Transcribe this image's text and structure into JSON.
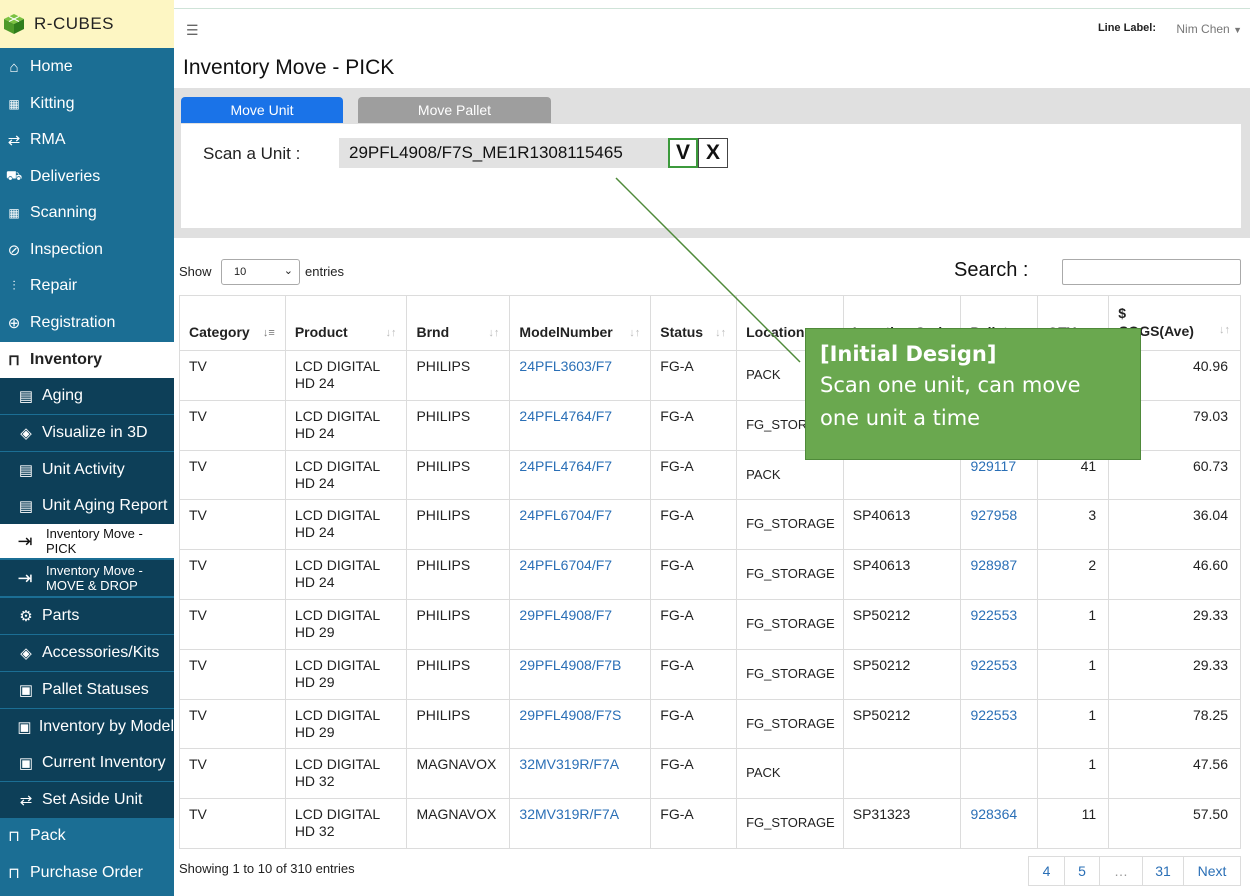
{
  "brand": {
    "name": "R-CUBES"
  },
  "sidebar": {
    "items": [
      {
        "label": "Home",
        "icon": "home-icon"
      },
      {
        "label": "Kitting",
        "icon": "qr-icon"
      },
      {
        "label": "RMA",
        "icon": "swap-icon"
      },
      {
        "label": "Deliveries",
        "icon": "truck-icon"
      },
      {
        "label": "Scanning",
        "icon": "qr-icon"
      },
      {
        "label": "Inspection",
        "icon": "compass-icon"
      },
      {
        "label": "Repair",
        "icon": "sliders-icon"
      },
      {
        "label": "Registration",
        "icon": "plus-circle-icon"
      },
      {
        "label": "Inventory",
        "icon": "bag-icon"
      }
    ],
    "sub_items": [
      {
        "label": "Aging",
        "icon": "clipboard-icon"
      },
      {
        "label": "Visualize in 3D",
        "icon": "cube-icon"
      },
      {
        "label": "Unit Activity",
        "icon": "clipboard-icon"
      },
      {
        "label": "Unit Aging Report",
        "icon": "clipboard-icon"
      },
      {
        "label": "Inventory Move - PICK",
        "icon": "move-icon"
      },
      {
        "label": "Inventory Move -MOVE & DROP",
        "icon": "move-icon"
      },
      {
        "label": "Parts",
        "icon": "gear-icon"
      },
      {
        "label": "Accessories/Kits",
        "icon": "cube-icon"
      },
      {
        "label": "Pallet Statuses",
        "icon": "clipboard-check-icon"
      },
      {
        "label": "Inventory by Model",
        "icon": "clipboard-check-icon"
      },
      {
        "label": "Current Inventory",
        "icon": "clipboard-check-icon"
      },
      {
        "label": "Set Aside Unit",
        "icon": "swap-icon"
      }
    ],
    "bottom_items": [
      {
        "label": "Pack",
        "icon": "bag-icon"
      },
      {
        "label": "Purchase Order",
        "icon": "bag-icon"
      }
    ]
  },
  "topbar": {
    "line_label": "Line Label:",
    "user": "Nim Chen"
  },
  "page": {
    "title": "Inventory Move - PICK"
  },
  "tabs": {
    "move_unit": "Move Unit",
    "move_pallet": "Move Pallet"
  },
  "scan": {
    "label": "Scan a Unit :",
    "value": "29PFL4908/F7S_ME1R1308115465",
    "confirm": "V",
    "cancel": "X"
  },
  "table_controls": {
    "show": "Show",
    "page_size": "10",
    "entries": "entries",
    "search": "Search :"
  },
  "table": {
    "columns": [
      "Category",
      "Product",
      "Brnd",
      "ModelNumber",
      "Status",
      "Location",
      "Location Code",
      "Pallet",
      "QTY",
      "$ COGS(Ave)"
    ],
    "rows": [
      {
        "category": "TV",
        "product": "LCD DIGITAL HD 24",
        "brand": "PHILIPS",
        "model": "24PFL3603/F7",
        "status": "FG-A",
        "location": "PACK",
        "location_code": "",
        "pallet": "",
        "qty": "",
        "cogs": "40.96"
      },
      {
        "category": "TV",
        "product": "LCD DIGITAL HD 24",
        "brand": "PHILIPS",
        "model": "24PFL4764/F7",
        "status": "FG-A",
        "location": "FG_STORAGE",
        "location_code": "",
        "pallet": "",
        "qty": "",
        "cogs": "79.03"
      },
      {
        "category": "TV",
        "product": "LCD DIGITAL HD 24",
        "brand": "PHILIPS",
        "model": "24PFL4764/F7",
        "status": "FG-A",
        "location": "PACK",
        "location_code": "",
        "pallet": "929117",
        "qty": "41",
        "cogs": "60.73"
      },
      {
        "category": "TV",
        "product": "LCD DIGITAL HD 24",
        "brand": "PHILIPS",
        "model": "24PFL6704/F7",
        "status": "FG-A",
        "location": "FG_STORAGE",
        "location_code": "SP40613",
        "pallet": "927958",
        "qty": "3",
        "cogs": "36.04"
      },
      {
        "category": "TV",
        "product": "LCD DIGITAL HD 24",
        "brand": "PHILIPS",
        "model": "24PFL6704/F7",
        "status": "FG-A",
        "location": "FG_STORAGE",
        "location_code": "SP40613",
        "pallet": "928987",
        "qty": "2",
        "cogs": "46.60"
      },
      {
        "category": "TV",
        "product": "LCD DIGITAL HD 29",
        "brand": "PHILIPS",
        "model": "29PFL4908/F7",
        "status": "FG-A",
        "location": "FG_STORAGE",
        "location_code": "SP50212",
        "pallet": "922553",
        "qty": "1",
        "cogs": "29.33"
      },
      {
        "category": "TV",
        "product": "LCD DIGITAL HD 29",
        "brand": "PHILIPS",
        "model": "29PFL4908/F7B",
        "status": "FG-A",
        "location": "FG_STORAGE",
        "location_code": "SP50212",
        "pallet": "922553",
        "qty": "1",
        "cogs": "29.33"
      },
      {
        "category": "TV",
        "product": "LCD DIGITAL HD 29",
        "brand": "PHILIPS",
        "model": "29PFL4908/F7S",
        "status": "FG-A",
        "location": "FG_STORAGE",
        "location_code": "SP50212",
        "pallet": "922553",
        "qty": "1",
        "cogs": "78.25"
      },
      {
        "category": "TV",
        "product": "LCD DIGITAL HD 32",
        "brand": "MAGNAVOX",
        "model": "32MV319R/F7A",
        "status": "FG-A",
        "location": "PACK",
        "location_code": "",
        "pallet": "",
        "qty": "1",
        "cogs": "47.56"
      },
      {
        "category": "TV",
        "product": "LCD DIGITAL HD 32",
        "brand": "MAGNAVOX",
        "model": "32MV319R/F7A",
        "status": "FG-A",
        "location": "FG_STORAGE",
        "location_code": "SP31323",
        "pallet": "928364",
        "qty": "11",
        "cogs": "57.50"
      }
    ]
  },
  "footer": {
    "info": "Showing 1 to 10 of 310 entries"
  },
  "pagination": [
    "4",
    "5",
    "…",
    "31",
    "Next"
  ],
  "callout": {
    "title": "[Initial Design]",
    "body": "Scan one unit, can move one unit a time"
  },
  "colors": {
    "sidebar": "#1b6e94",
    "sidebar_sub": "#0d3f58",
    "brand_bg": "#fdf6c3",
    "tab_active": "#1a73e8",
    "tab_inactive": "#9e9e9e",
    "link": "#2a6fb6",
    "callout": "#6aa84f"
  }
}
